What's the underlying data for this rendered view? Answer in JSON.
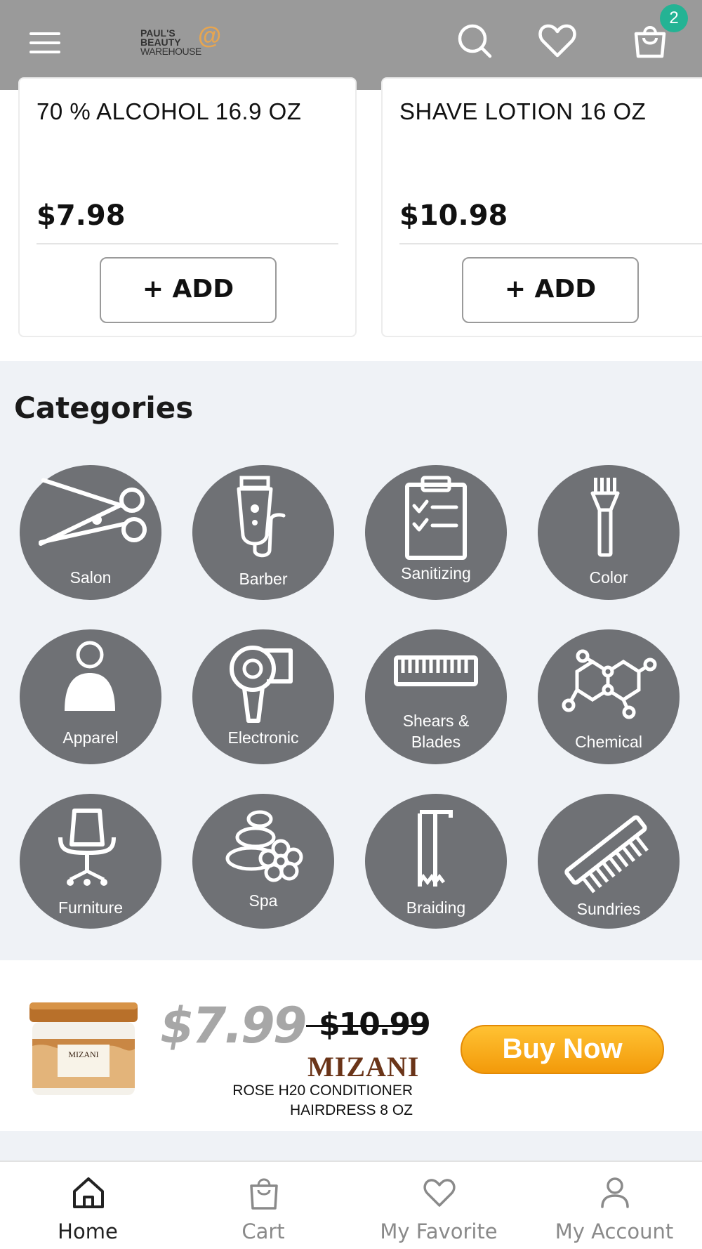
{
  "header": {
    "logo_line1": "PAUL'S",
    "logo_line2": "BEAUTY",
    "logo_line3": "WAREHOUSE",
    "logo_at": "@",
    "cart_count": "2",
    "icons": [
      "menu-icon",
      "search-icon",
      "heart-icon",
      "cart-icon"
    ]
  },
  "products": [
    {
      "name": "70 % ALCOHOL 16.9 OZ",
      "price": "$7.98",
      "button": "+ ADD"
    },
    {
      "name": "SHAVE LOTION 16 OZ",
      "price": "$10.98",
      "button": "+ ADD"
    }
  ],
  "categories": {
    "title": "Categories",
    "items": [
      {
        "label": "Salon",
        "icon": "scissors-icon"
      },
      {
        "label": "Barber",
        "icon": "clipper-icon"
      },
      {
        "label": "Sanitizing",
        "icon": "clipboard-check-icon"
      },
      {
        "label": "Color",
        "icon": "color-brush-icon"
      },
      {
        "label": "Apparel",
        "icon": "person-apparel-icon"
      },
      {
        "label": "Electronic",
        "icon": "hair-dryer-icon"
      },
      {
        "label_line1": "Shears &",
        "label_line2": "Blades",
        "icon": "blade-icon"
      },
      {
        "label": "Chemical",
        "icon": "molecule-icon"
      },
      {
        "label": "Furniture",
        "icon": "salon-chair-icon"
      },
      {
        "label": "Spa",
        "icon": "spa-stones-icon"
      },
      {
        "label": "Braiding",
        "icon": "braiding-hair-icon"
      },
      {
        "label": "Sundries",
        "icon": "comb-icon"
      }
    ]
  },
  "promo": {
    "price": "$7.99",
    "old_price": "$10.99",
    "brand": "MIZANI",
    "jar_brand": "MIZANI",
    "description_line1": "ROSE H20 CONDITIONER",
    "description_line2": "HAIRDRESS 8 OZ",
    "button": "Buy Now"
  },
  "bottom_nav": [
    {
      "label": "Home",
      "icon": "home-icon",
      "active": true
    },
    {
      "label": "Cart",
      "icon": "cart-icon",
      "active": false
    },
    {
      "label": "My Favorite",
      "icon": "heart-icon",
      "active": false
    },
    {
      "label": "My Account",
      "icon": "user-icon",
      "active": false
    }
  ],
  "colors": {
    "header_bg": "#9a9a9a",
    "badge": "#24b394",
    "category_circle": "#6f7175",
    "category_bg": "#eff2f6",
    "buy_now": "#f7a91c",
    "logo_accent": "#e7a550"
  }
}
